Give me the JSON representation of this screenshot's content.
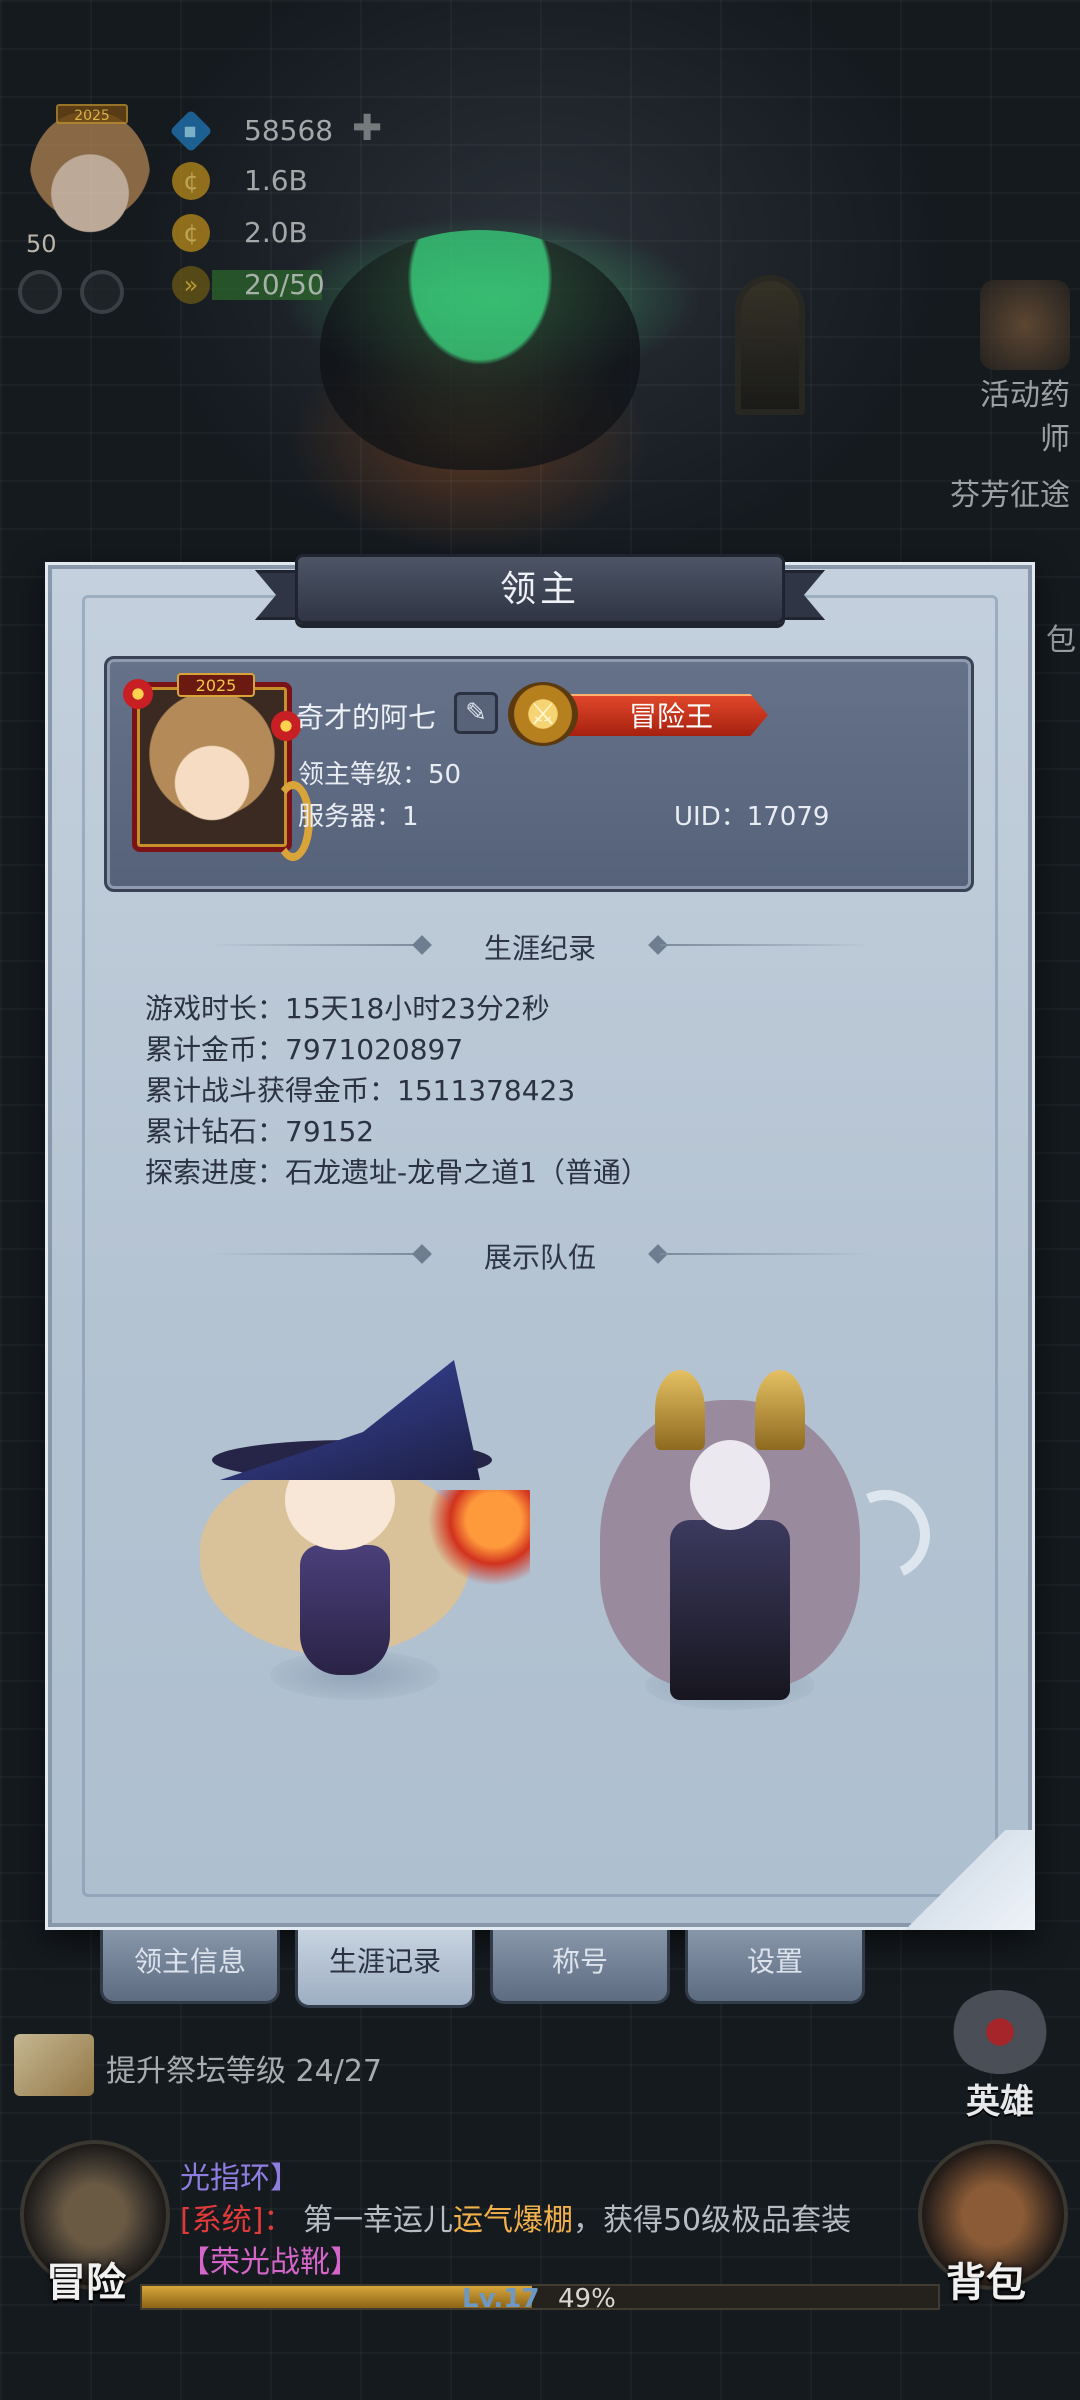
{
  "hud": {
    "player_level": "50",
    "avatar_year": "2025",
    "diamonds": "58568",
    "gold": "1.6B",
    "gold2": "2.0B",
    "energy": "20/50"
  },
  "side_buttons": {
    "activity": "活动药师",
    "event": "芬芳征途",
    "pack": "包"
  },
  "panel": {
    "title": "领主",
    "profile": {
      "year": "2025",
      "name": "奇才的阿七",
      "title_badge": "冒险王",
      "level_label": "领主等级：50",
      "server_label": "服务器：1",
      "uid_label": "UID：17079"
    },
    "career_header": "生涯纪录",
    "stats": [
      "游戏时长：15天18小时23分2秒",
      "累计金币：7971020897",
      "累计战斗获得金币：1511378423",
      "累计钻石：79152",
      "探索进度：石龙遗址-龙骨之道1（普通）"
    ],
    "team_header": "展示队伍",
    "tabs": [
      "领主信息",
      "生涯记录",
      "称号",
      "设置"
    ],
    "active_tab": 1
  },
  "bottom": {
    "quest": "提升祭坛等级 24/27",
    "hero_label": "英雄",
    "adventure_label": "冒险",
    "bag_label": "背包",
    "chat": {
      "line1": "光指环】",
      "system": "[系统]",
      "colon": "：",
      "msg_a": "第一幸运儿",
      "msg_b": "运气爆棚",
      "msg_c": "，获得50级极品套装",
      "item": "【荣光战靴】"
    },
    "exp_level": "Lv.17",
    "exp_percent": "49%",
    "exp_fraction": 0.49
  }
}
